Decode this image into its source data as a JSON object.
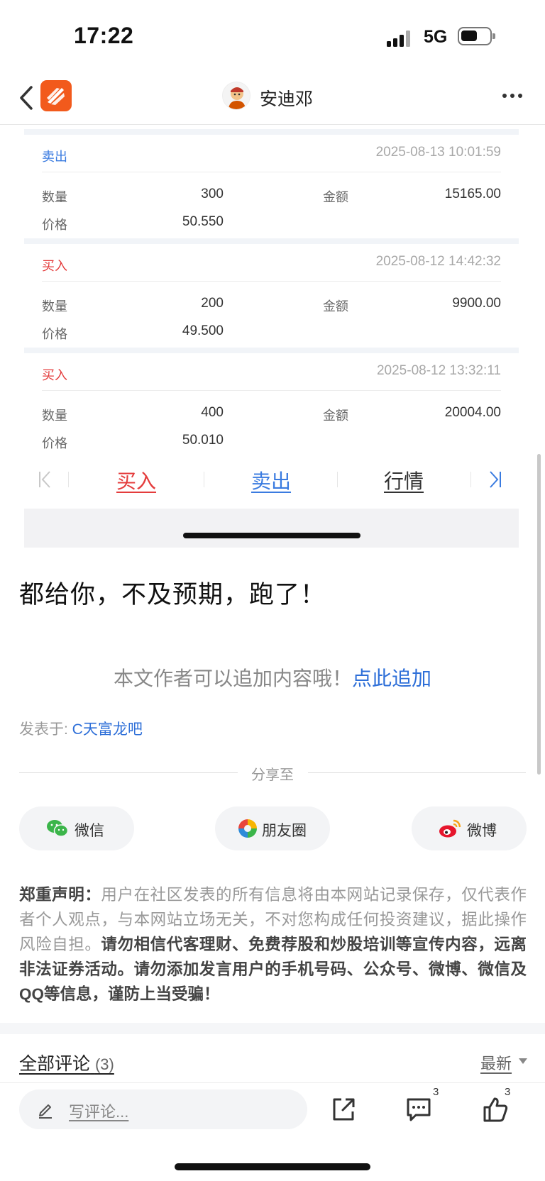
{
  "status_bar": {
    "time": "17:22",
    "network": "5G"
  },
  "header": {
    "title": "安迪邓"
  },
  "trades": [
    {
      "type": "卖出",
      "kind": "sell",
      "time": "2025-08-13 10:01:59",
      "qty_label": "数量",
      "qty": "300",
      "amount_label": "金额",
      "amount": "15165.00",
      "price_label": "价格",
      "price": "50.550"
    },
    {
      "type": "买入",
      "kind": "buy",
      "time": "2025-08-12 14:42:32",
      "qty_label": "数量",
      "qty": "200",
      "amount_label": "金额",
      "amount": "9900.00",
      "price_label": "价格",
      "price": "49.500"
    },
    {
      "type": "买入",
      "kind": "buy",
      "time": "2025-08-12 13:32:11",
      "qty_label": "数量",
      "qty": "400",
      "amount_label": "金额",
      "amount": "20004.00",
      "price_label": "价格",
      "price": "50.010"
    }
  ],
  "actions": {
    "buy": "买入",
    "sell": "卖出",
    "market": "行情"
  },
  "post": {
    "text": "都给你，不及预期，跑了！",
    "append_prompt": "本文作者可以追加内容哦！",
    "append_link": "点此追加",
    "posted_in_label": "发表于: ",
    "forum": "C天富龙吧"
  },
  "share": {
    "label": "分享至",
    "wechat": "微信",
    "moments": "朋友圈",
    "weibo": "微博"
  },
  "disclaimer": {
    "title": "郑重声明",
    "colon": "：",
    "normal": "用户在社区发表的所有信息将由本网站记录保存，仅代表作者个人观点，与本网站立场无关，不对您构成任何投资建议，据此操作风险自担。",
    "bold": "请勿相信代客理财、免费荐股和炒股培训等宣传内容，远离非法证券活动。请勿添加发言用户的手机号码、公众号、微博、微信及QQ等信息，谨防上当受骗！"
  },
  "comments": {
    "title": "全部评论",
    "count": "(3)",
    "sort": "最新"
  },
  "bottom_bar": {
    "placeholder": "写评论...",
    "comment_count": "3",
    "like_count": "3"
  },
  "colors": {
    "buy": "#e43c3c",
    "sell": "#3a7be0",
    "link": "#2e6fd8",
    "brand": "#f25a1c"
  }
}
